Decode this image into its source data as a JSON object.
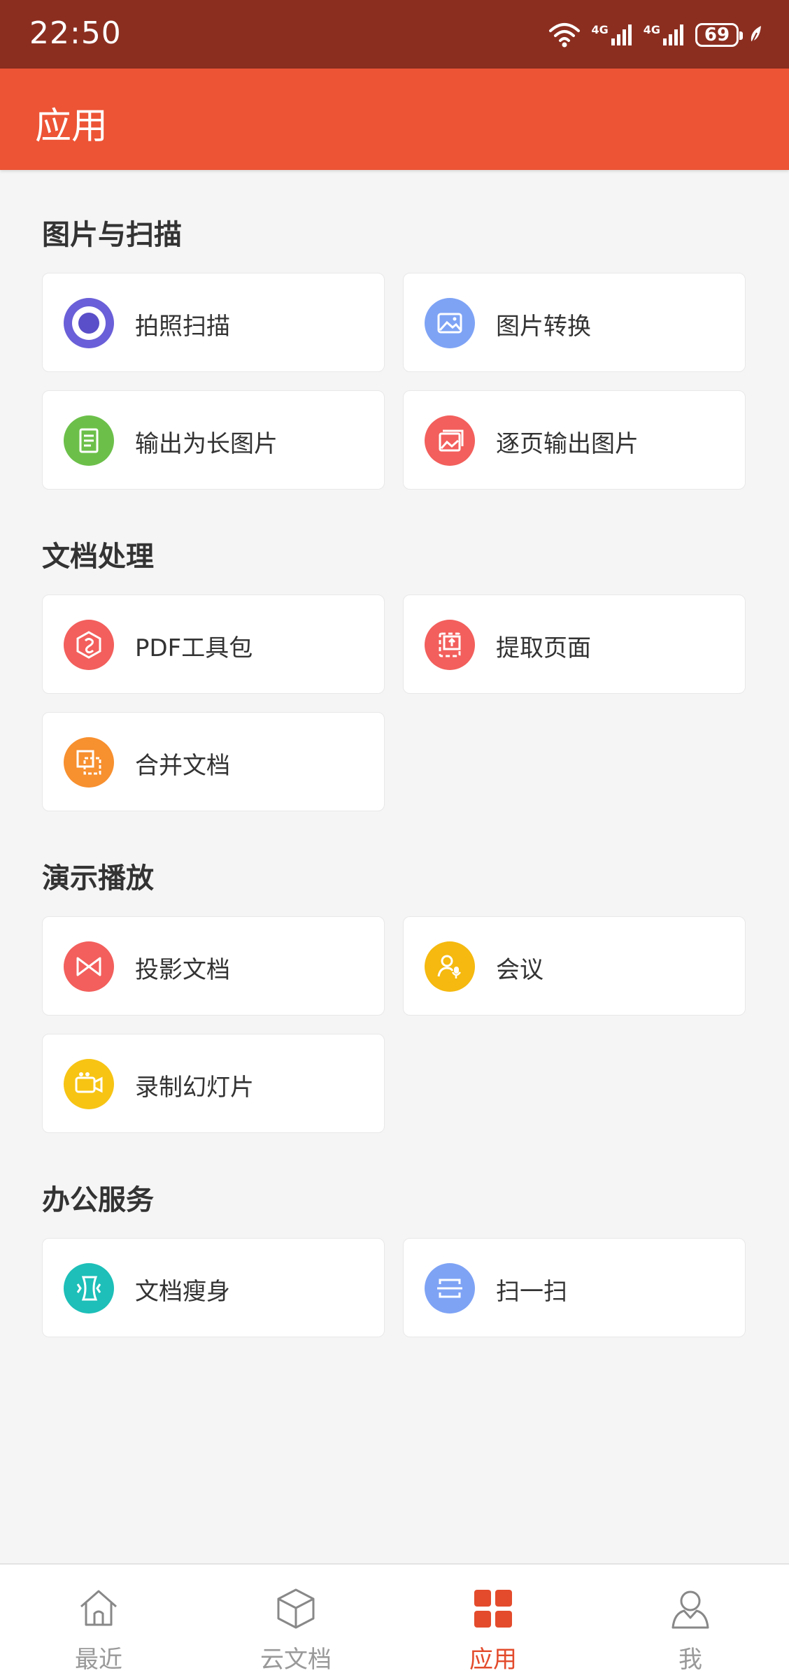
{
  "status_bar": {
    "time": "22:50",
    "battery": "69",
    "network_1": "4G",
    "network_2": "4G"
  },
  "app_bar": {
    "title": "应用"
  },
  "sections": [
    {
      "title": "图片与扫描",
      "items": [
        {
          "label": "拍照扫描",
          "icon": "camera-scan-icon",
          "color": "#6a5fd8"
        },
        {
          "label": "图片转换",
          "icon": "image-convert-icon",
          "color": "#7ea3f5"
        },
        {
          "label": "输出为长图片",
          "icon": "long-image-icon",
          "color": "#6cc04a"
        },
        {
          "label": "逐页输出图片",
          "icon": "page-images-icon",
          "color": "#f25f5c"
        }
      ]
    },
    {
      "title": "文档处理",
      "items": [
        {
          "label": "PDF工具包",
          "icon": "pdf-toolkit-icon",
          "color": "#f25f5c"
        },
        {
          "label": "提取页面",
          "icon": "extract-page-icon",
          "color": "#f25f5c"
        },
        {
          "label": "合并文档",
          "icon": "merge-docs-icon",
          "color": "#f7902f"
        }
      ]
    },
    {
      "title": "演示播放",
      "items": [
        {
          "label": "投影文档",
          "icon": "projection-icon",
          "color": "#f25f5c"
        },
        {
          "label": "会议",
          "icon": "meeting-icon",
          "color": "#f5b90f"
        },
        {
          "label": "录制幻灯片",
          "icon": "record-slides-icon",
          "color": "#f7c414"
        }
      ]
    },
    {
      "title": "办公服务",
      "items": [
        {
          "label": "文档瘦身",
          "icon": "slim-doc-icon",
          "color": "#1dbfb8"
        },
        {
          "label": "扫一扫",
          "icon": "scan-icon",
          "color": "#7ea3f5"
        }
      ]
    }
  ],
  "bottom_nav": [
    {
      "label": "最近",
      "icon": "home-icon",
      "active": false
    },
    {
      "label": "云文档",
      "icon": "cloud-doc-icon",
      "active": false
    },
    {
      "label": "应用",
      "icon": "apps-grid-icon",
      "active": true
    },
    {
      "label": "我",
      "icon": "profile-icon",
      "active": false
    }
  ],
  "colors": {
    "accent": "#ec5435",
    "status_bar": "#8b2e20",
    "active_nav": "#e34b2c"
  }
}
